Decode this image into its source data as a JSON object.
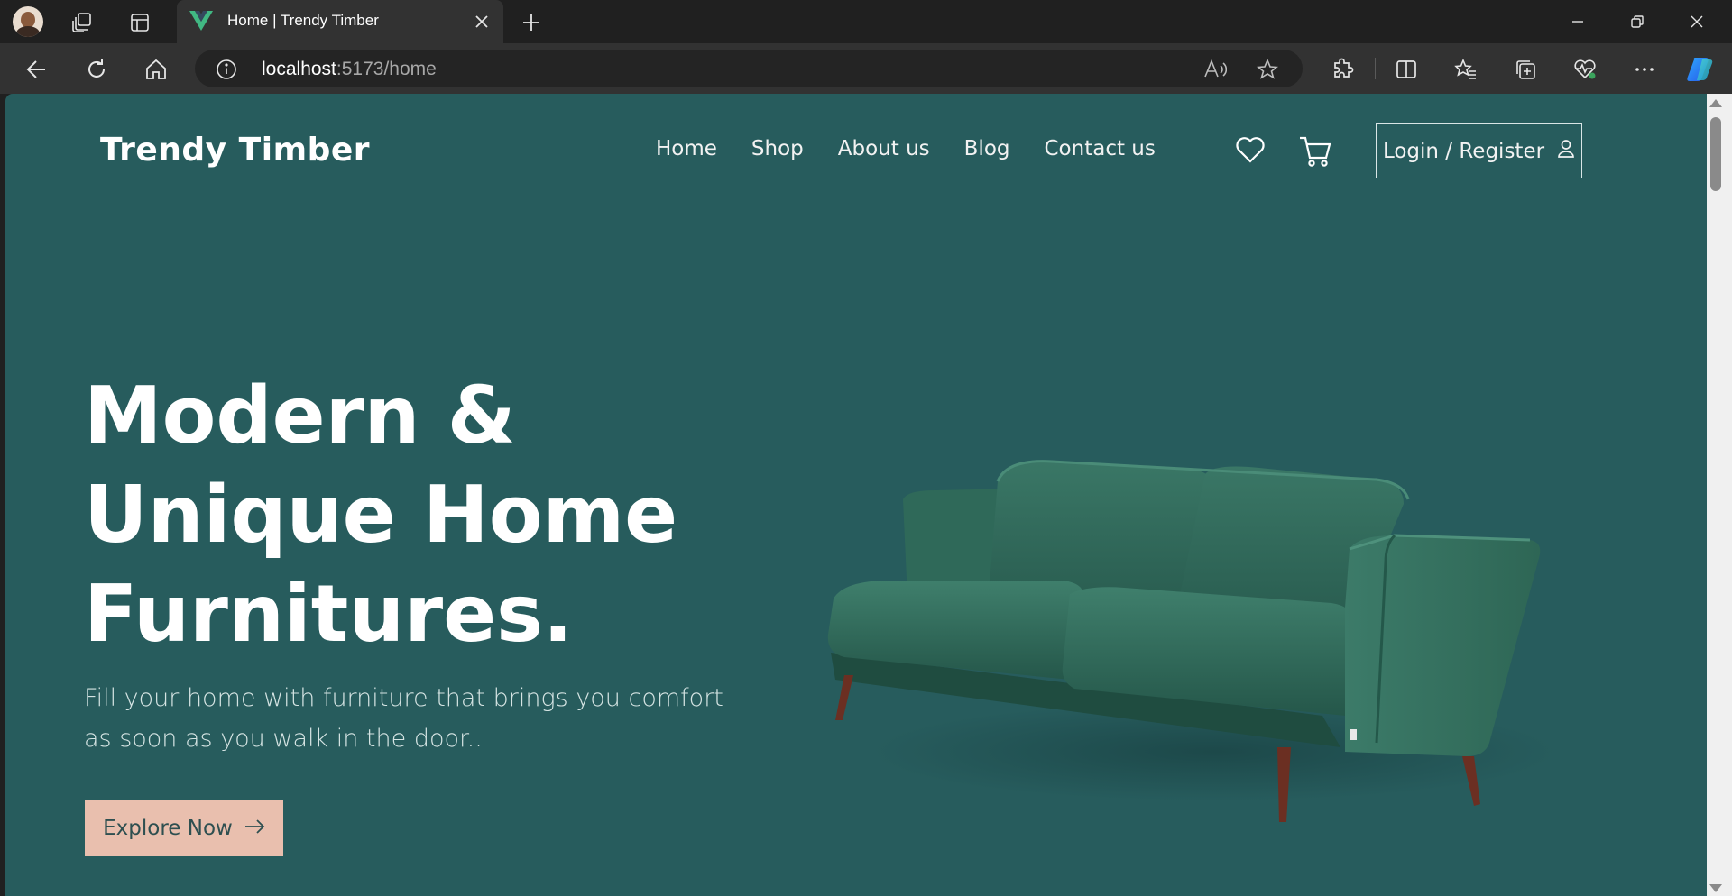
{
  "browser": {
    "tab": {
      "title": "Home | Trendy Timber"
    },
    "address": {
      "host": "localhost",
      "path": ":5173/home"
    }
  },
  "page": {
    "brand": "Trendy Timber",
    "nav": {
      "items": [
        {
          "label": "Home"
        },
        {
          "label": "Shop"
        },
        {
          "label": "About us"
        },
        {
          "label": "Blog"
        },
        {
          "label": "Contact us"
        }
      ]
    },
    "login_label": "Login / Register",
    "hero": {
      "title_line1": "Modern &",
      "title_line2": "Unique Home",
      "title_line3": "Furnitures.",
      "subtitle": "Fill your home with furniture that brings you comfort as soon as you walk in the door..",
      "cta_label": "Explore Now"
    }
  },
  "colors": {
    "page_bg": "#275c5d",
    "cta_bg": "#e9bfae",
    "chrome_bg": "#202020",
    "toolbar_bg": "#323232",
    "sofa": "#2f6b5c"
  },
  "icons": [
    "heart-icon",
    "cart-icon",
    "user-icon",
    "arrow-right-icon",
    "vue-logo-icon"
  ]
}
